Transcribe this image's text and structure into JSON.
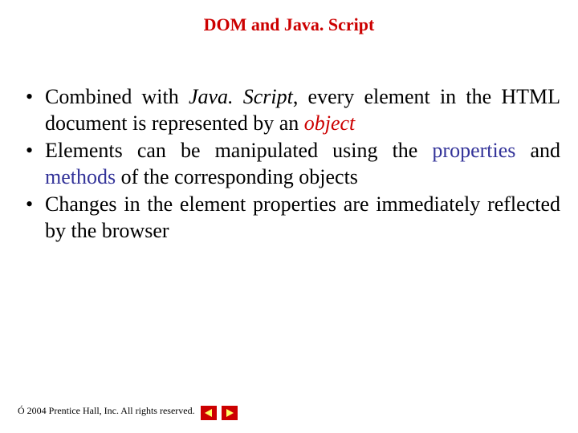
{
  "title": "DOM and Java. Script",
  "bullets": [
    {
      "pre": "Combined with ",
      "t1": "Java. Script",
      "mid1": ", every element in the HTML document is represented by an ",
      "t2": "object",
      "post": ""
    },
    {
      "pre": "Elements can be manipulated using the ",
      "t1": "properties",
      "mid1": " and ",
      "t2": "methods",
      "post": " of the corresponding objects"
    },
    {
      "pre": "Changes in the element properties are immediately reflected by the browser",
      "t1": "",
      "mid1": "",
      "t2": "",
      "post": ""
    }
  ],
  "footer": {
    "copyright_symbol": "Ó",
    "text": " 2004 Prentice Hall, Inc.  All rights reserved."
  }
}
